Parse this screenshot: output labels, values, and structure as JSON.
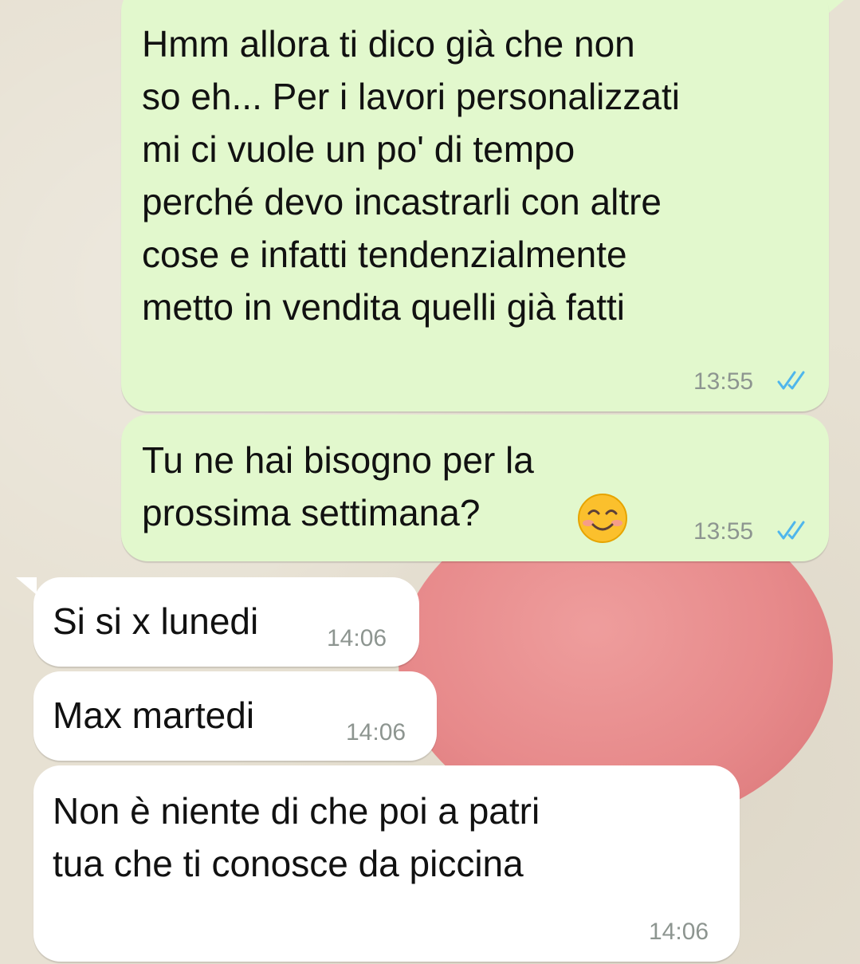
{
  "messages": [
    {
      "direction": "outgoing",
      "text": "Hmm allora ti dico già che non\nso eh... Per i lavori personalizzati\nmi ci vuole un po' di tempo\nperché devo incastrarli con altre\ncose e infatti tendenzialmente\nmetto in vendita quelli già fatti",
      "time": "13:55",
      "status": "read"
    },
    {
      "direction": "outgoing",
      "text": "Tu ne hai bisogno per la\nprossima settimana?",
      "emoji": "smiling-face-with-smiling-eyes",
      "time": "13:55",
      "status": "read"
    },
    {
      "direction": "incoming",
      "text": "Si si x lunedi",
      "time": "14:06"
    },
    {
      "direction": "incoming",
      "text": "Max martedi",
      "time": "14:06"
    },
    {
      "direction": "incoming",
      "text": "Non è niente di che poi a patri\ntua che ti conosce da piccina",
      "time": "14:06"
    }
  ],
  "colors": {
    "outgoing_bubble": "#e2f8cd",
    "incoming_bubble": "#ffffff",
    "read_ticks": "#4fb6ec",
    "timestamp": "#8d9590"
  }
}
